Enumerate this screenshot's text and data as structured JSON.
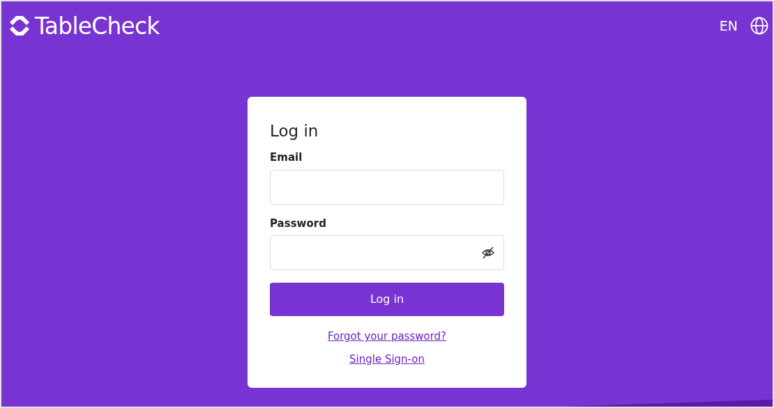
{
  "header": {
    "brand": "TableCheck",
    "language": "EN"
  },
  "login": {
    "title": "Log in",
    "fields": [
      {
        "label": "Email",
        "kind": "text"
      },
      {
        "label": "Password",
        "kind": "password"
      }
    ],
    "submit": "Log in",
    "links": [
      "Forgot your password?",
      "Single Sign-on"
    ]
  }
}
